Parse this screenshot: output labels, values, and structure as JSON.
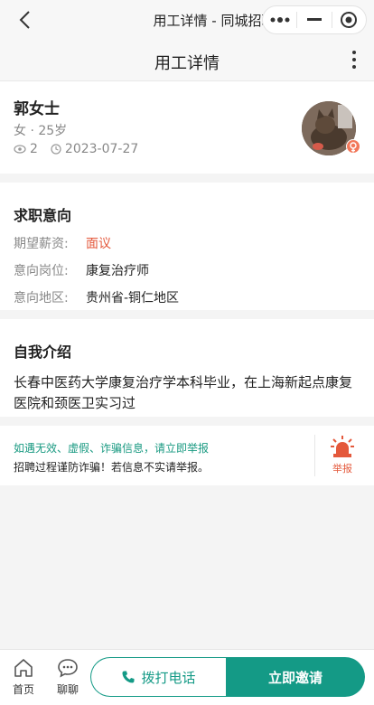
{
  "window": {
    "title": "用工详情 - 同城招聘"
  },
  "header": {
    "title": "用工详情"
  },
  "profile": {
    "name": "郭女士",
    "gender_age": "女 · 25岁",
    "views": "2",
    "date": "2023-07-27"
  },
  "intent": {
    "title": "求职意向",
    "rows": [
      {
        "key": "期望薪资:",
        "value": "面议"
      },
      {
        "key": "意向岗位:",
        "value": "康复治疗师"
      },
      {
        "key": "意向地区:",
        "value": "贵州省-铜仁地区"
      }
    ]
  },
  "intro": {
    "title": "自我介绍",
    "text": "长春中医药大学康复治疗学本科毕业，在上海新起点康复医院和颈医卫实习过"
  },
  "report": {
    "line1": "如遇无效、虚假、诈骗信息，请立即举报",
    "line2": "招聘过程谨防诈骗！若信息不实请举报。",
    "button_label": "举报"
  },
  "bottom": {
    "home_label": "首页",
    "chat_label": "聊聊",
    "call_label": "拨打电话",
    "invite_label": "立即邀请"
  },
  "colors": {
    "accent": "#149a86",
    "warning": "#e4593c",
    "notice": "#1a9a82"
  }
}
